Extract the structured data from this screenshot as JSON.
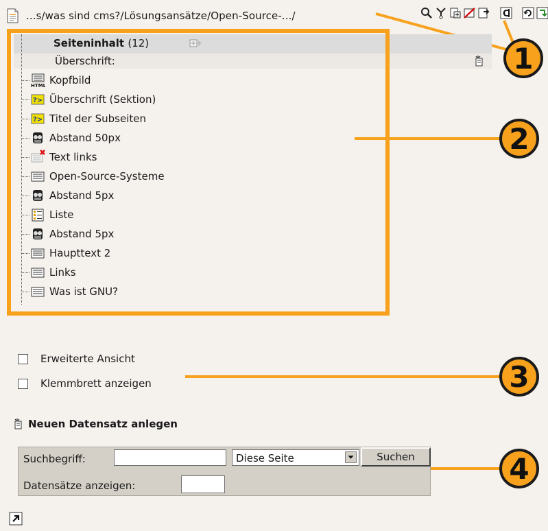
{
  "path": {
    "text": "...s/was sind cms?/Lösungsansätze/Open-Source-.../",
    "icon": "page-icon"
  },
  "toolbar": {
    "icons": [
      "view-icon",
      "move-icon",
      "new-record-icon",
      "hide-icon",
      "export-icon",
      "clear-cache-icon",
      "refresh-icon",
      "reload-icon"
    ]
  },
  "tree": {
    "title": "Seiteninhalt",
    "count": "(12)",
    "subheader": "Überschrift:",
    "items": [
      {
        "label": "Kopfbild",
        "icon": "html-content-icon"
      },
      {
        "label": "Überschrift (Sektion)",
        "icon": "script-content-icon"
      },
      {
        "label": "Titel der Subseiten",
        "icon": "script-content-icon"
      },
      {
        "label": "Abstand 50px",
        "icon": "spacer-content-icon"
      },
      {
        "label": "Text links",
        "icon": "hidden-text-content-icon"
      },
      {
        "label": "Open-Source-Systeme",
        "icon": "text-content-icon"
      },
      {
        "label": "Abstand 5px",
        "icon": "spacer-content-icon"
      },
      {
        "label": "Liste",
        "icon": "list-content-icon"
      },
      {
        "label": "Abstand 5px",
        "icon": "spacer-content-icon"
      },
      {
        "label": "Haupttext 2",
        "icon": "text-content-icon"
      },
      {
        "label": "Links",
        "icon": "text-content-icon"
      },
      {
        "label": "Was ist GNU?",
        "icon": "text-content-icon"
      }
    ]
  },
  "options": {
    "extended_view": "Erweiterte Ansicht",
    "show_clipboard": "Klemmbrett anzeigen"
  },
  "new_record": {
    "label": "Neuen Datensatz anlegen"
  },
  "search": {
    "label": "Suchbegriff:",
    "value": "",
    "scope": "Diese Seite",
    "button": "Suchen",
    "records_label": "Datensätze anzeigen:",
    "records_value": ""
  },
  "callouts": [
    "1",
    "2",
    "3",
    "4"
  ],
  "colors": {
    "accent": "#f7a11c",
    "background": "#f5f1ed",
    "panel": "#d4d0c8"
  }
}
